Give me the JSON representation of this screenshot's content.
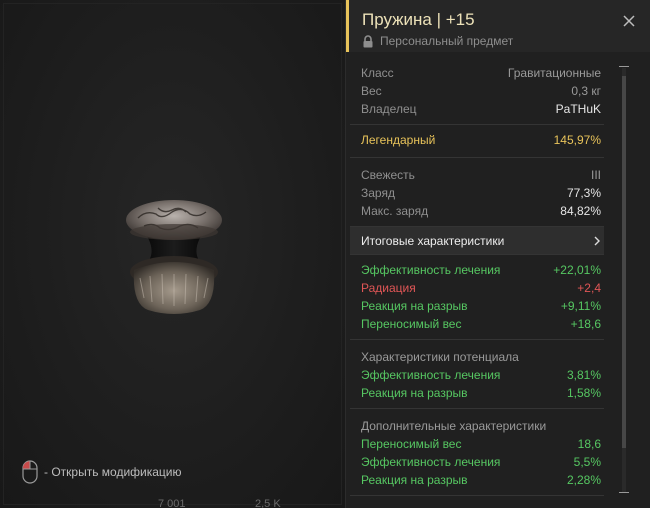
{
  "item": {
    "name": "Пружина | +15",
    "ownership": "Персональный предмет"
  },
  "info": [
    {
      "label": "Класс",
      "value": "Гравитационные"
    },
    {
      "label": "Вес",
      "value": "0,3 кг"
    },
    {
      "label": "Владелец",
      "value": "PaTHuK"
    }
  ],
  "rarity": {
    "label": "Легендарный",
    "value": "145,97%"
  },
  "condition": [
    {
      "label": "Свежесть",
      "value": "III"
    },
    {
      "label": "Заряд",
      "value": "77,3%"
    },
    {
      "label": "Макс. заряд",
      "value": "84,82%"
    }
  ],
  "totals_label": "Итоговые характеристики",
  "total_stats": [
    {
      "label": "Эффективность лечения",
      "value": "+22,01%",
      "tone": "green"
    },
    {
      "label": "Радиация",
      "value": "+2,4",
      "tone": "red"
    },
    {
      "label": "Реакция на разрыв",
      "value": "+9,11%",
      "tone": "green"
    },
    {
      "label": "Переносимый вес",
      "value": "+18,6",
      "tone": "green"
    }
  ],
  "potential": {
    "title": "Характеристики потенциала",
    "stats": [
      {
        "label": "Эффективность лечения",
        "value": "3,81%"
      },
      {
        "label": "Реакция на разрыв",
        "value": "1,58%"
      }
    ]
  },
  "additional": {
    "title": "Дополнительные характеристики",
    "stats": [
      {
        "label": "Переносимый вес",
        "value": "18,6"
      },
      {
        "label": "Эффективность лечения",
        "value": "5,5%"
      },
      {
        "label": "Реакция на разрыв",
        "value": "2,28%"
      }
    ]
  },
  "hint": "- Открыть модификацию",
  "background_fragments": [
    "7 001",
    "2,5 K"
  ],
  "colors": {
    "accent": "#e8c35a",
    "positive": "#56c762",
    "negative": "#e05656"
  }
}
